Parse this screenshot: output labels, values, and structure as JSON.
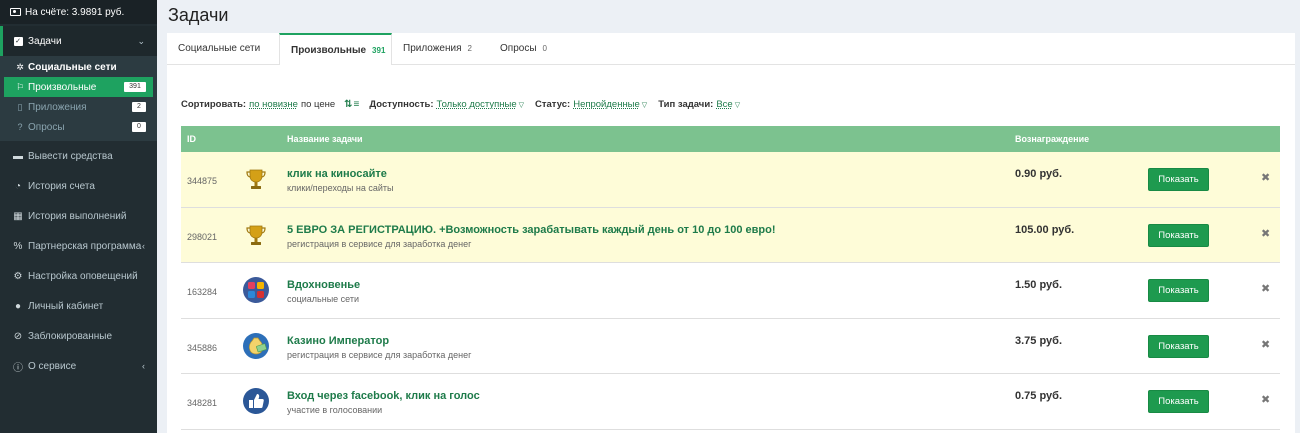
{
  "sidebar": {
    "balance": "На счёте: 3.9891 руб.",
    "tasks_label": "Задачи",
    "sub": [
      {
        "label": "Социальные сети",
        "badge": ""
      },
      {
        "label": "Произвольные",
        "badge": "391"
      },
      {
        "label": "Приложения",
        "badge": "2"
      },
      {
        "label": "Опросы",
        "badge": "0"
      }
    ],
    "items": [
      {
        "label": "Вывести средства"
      },
      {
        "label": "История счета"
      },
      {
        "label": "История выполнений"
      },
      {
        "label": "Партнерская программа"
      },
      {
        "label": "Настройка оповещений"
      },
      {
        "label": "Личный кабинет"
      },
      {
        "label": "Заблокированные"
      },
      {
        "label": "О сервисе"
      }
    ]
  },
  "page_title": "Задачи",
  "tabs": [
    {
      "label": "Социальные сети",
      "count": ""
    },
    {
      "label": "Произвольные",
      "count": "391"
    },
    {
      "label": "Приложения",
      "count": "2"
    },
    {
      "label": "Опросы",
      "count": "0"
    }
  ],
  "filters": {
    "sort_label": "Сортировать:",
    "sort_new": "по новизне",
    "sort_price": "по цене",
    "availability_label": "Доступность:",
    "availability_value": "Только доступные",
    "status_label": "Статус:",
    "status_value": "Непройденные",
    "type_label": "Тип задачи:",
    "type_value": "Все"
  },
  "table": {
    "columns": {
      "id": "ID",
      "name": "Название задачи",
      "reward": "Вознаграждение"
    },
    "button_label": "Показать",
    "rows": [
      {
        "id": "344875",
        "title": "клик на киносайте",
        "category": "клики/переходы на сайты",
        "reward": "0.90 руб.",
        "icon": "trophy-icon",
        "highlight": true
      },
      {
        "id": "298021",
        "title": "5 ЕВРО ЗА РЕГИСТРАЦИЮ. +Возможность зарабатывать каждый день от 10 до 100 евро!",
        "category": "регистрация в сервисе для заработка денег",
        "reward": "105.00 руб.",
        "icon": "trophy-icon",
        "highlight": true
      },
      {
        "id": "163284",
        "title": "Вдохновенье",
        "category": "социальные сети",
        "reward": "1.50 руб.",
        "icon": "social-apps-icon",
        "highlight": false
      },
      {
        "id": "345886",
        "title": "Казино Император",
        "category": "регистрация в сервисе для заработка денег",
        "reward": "3.75 руб.",
        "icon": "money-bag-icon",
        "highlight": false
      },
      {
        "id": "348281",
        "title": "Вход через facebook, клик на голос",
        "category": "участие в голосовании",
        "reward": "0.75 руб.",
        "icon": "thumbs-up-icon",
        "highlight": false
      }
    ]
  }
}
